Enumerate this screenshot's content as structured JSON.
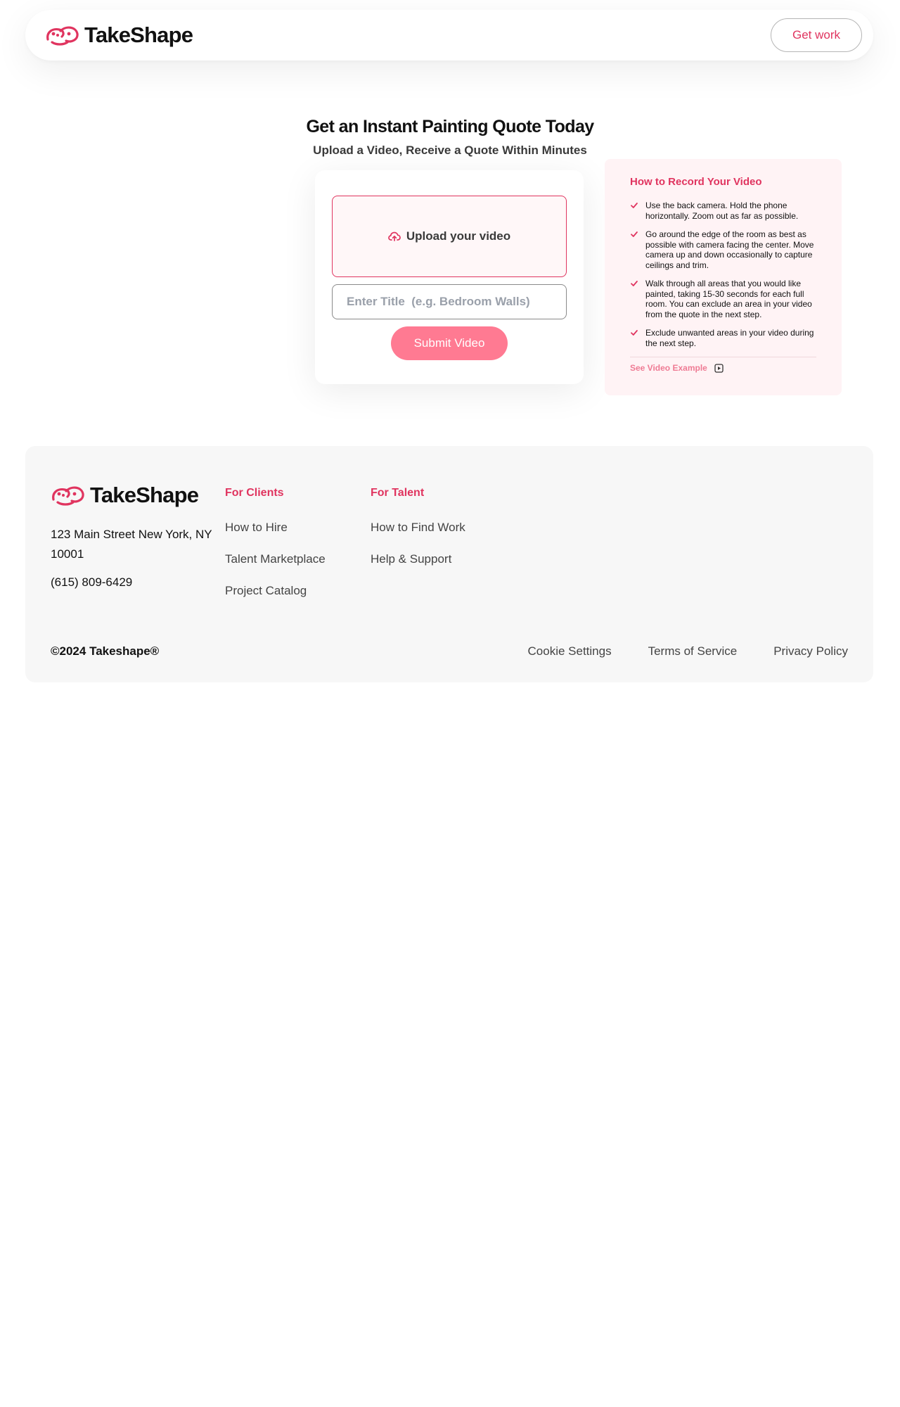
{
  "header": {
    "brand_name": "TakeShape",
    "get_work_label": "Get work"
  },
  "hero": {
    "title": "Get an Instant Painting Quote Today",
    "subtitle": "Upload a Video, Receive a Quote Within Minutes"
  },
  "upload": {
    "dropzone_label": "Upload your video",
    "title_placeholder": "Enter Title  (e.g. Bedroom Walls)",
    "submit_label": "Submit Video"
  },
  "howto": {
    "title": "How to Record Your Video",
    "items": [
      "Use the back camera. Hold the phone horizontally. Zoom out as far as possible.",
      "Go around the edge of the room as best as possible with camera facing the center. Move camera up and down occasionally to capture ceilings and trim.",
      "Walk through all areas that you would like painted, taking 15-30 seconds for each full room. You can exclude an area in your video from the quote in the next step.",
      "Exclude unwanted areas in your video during the next step."
    ],
    "video_example_label": "See Video Example"
  },
  "footer": {
    "brand_name": "TakeShape",
    "address": "123 Main Street New York, NY 10001",
    "phone": "(615) 809-6429",
    "clients": {
      "title": "For Clients",
      "links": [
        "How to Hire",
        "Talent Marketplace",
        "Project Catalog"
      ]
    },
    "talent": {
      "title": "For Talent",
      "links": [
        "How to Find Work",
        "Help & Support"
      ]
    },
    "copyright": "©2024 Takeshape®",
    "legal": [
      "Cookie Settings",
      "Terms of Service",
      "Privacy Policy"
    ]
  },
  "colors": {
    "accent": "#e0345f",
    "button_pink": "#ff7a92",
    "card_pink": "#fff3f5",
    "footer_bg": "#f7f7f7"
  },
  "icons": {
    "logo": "takeshape-logo-icon",
    "upload": "cloud-upload-icon",
    "check": "check-icon",
    "play": "play-icon"
  }
}
